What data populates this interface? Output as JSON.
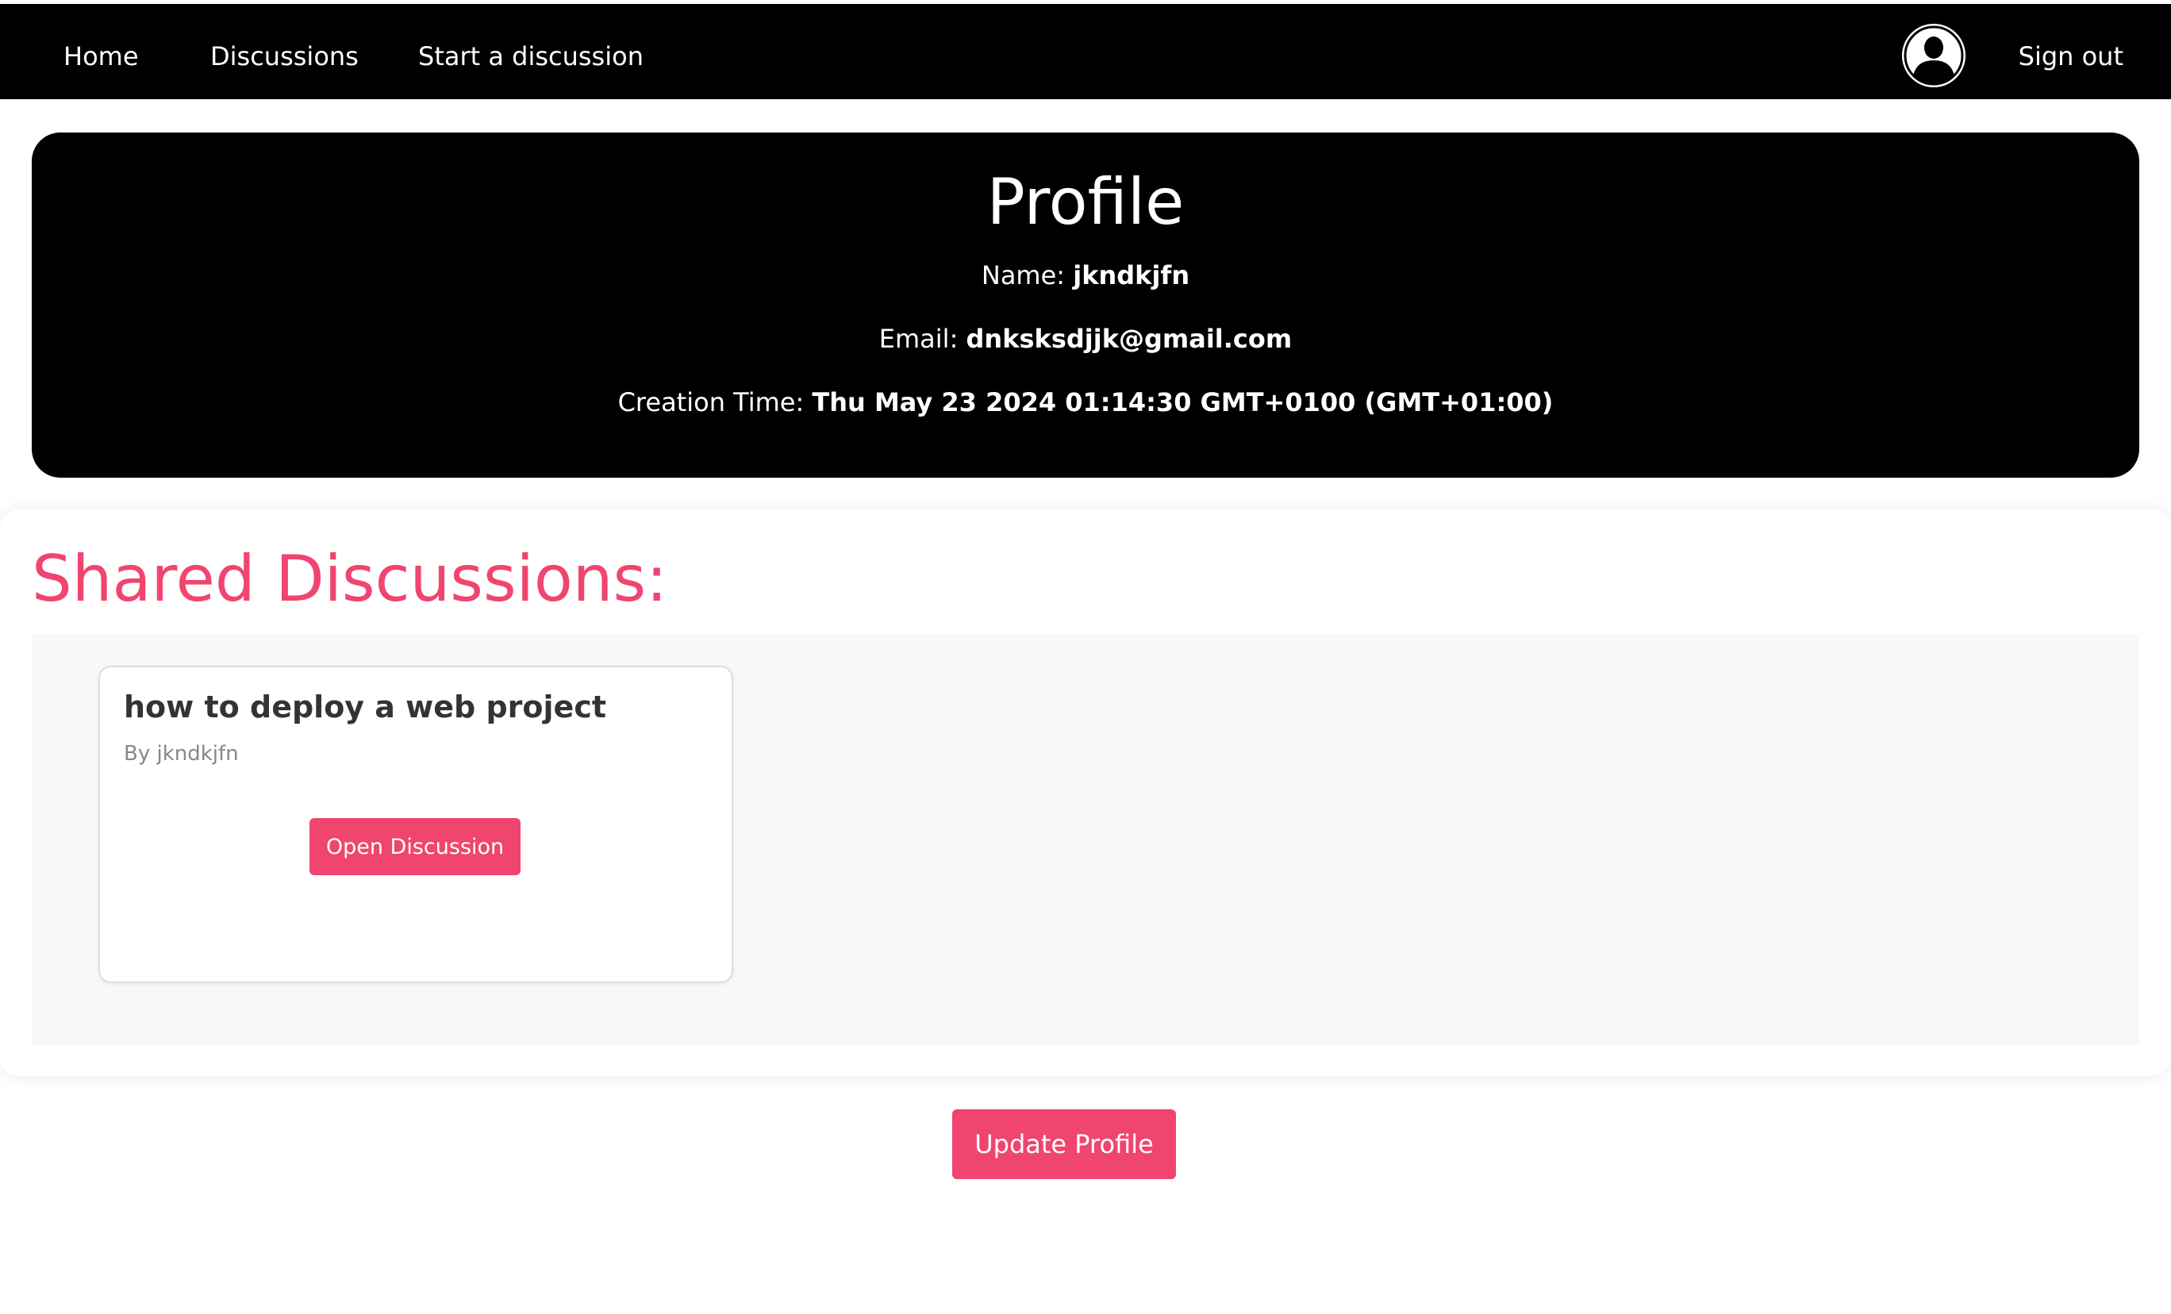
{
  "nav": {
    "home": "Home",
    "discussions": "Discussions",
    "start_discussion": "Start a discussion",
    "sign_out": "Sign out",
    "avatar_icon": "user-avatar-icon"
  },
  "profile": {
    "title": "Profile",
    "name_label": "Name:",
    "name_value": "jkndkjfn",
    "email_label": "Email:",
    "email_value": "dnksksdjjk@gmail.com",
    "time_label": "Creation Time:",
    "time_value": "Thu May 23 2024 01:14:30 GMT+0100 (GMT+01:00)"
  },
  "shared": {
    "title": "Shared Discussions:",
    "discussions": [
      {
        "title": "how to deploy a web project",
        "author": "By jkndkjfn",
        "button": "Open Discussion"
      }
    ]
  },
  "actions": {
    "update_profile": "Update Profile"
  },
  "colors": {
    "accent": "#f0456e",
    "nav_bg": "#000000",
    "profile_bg": "#000000"
  }
}
